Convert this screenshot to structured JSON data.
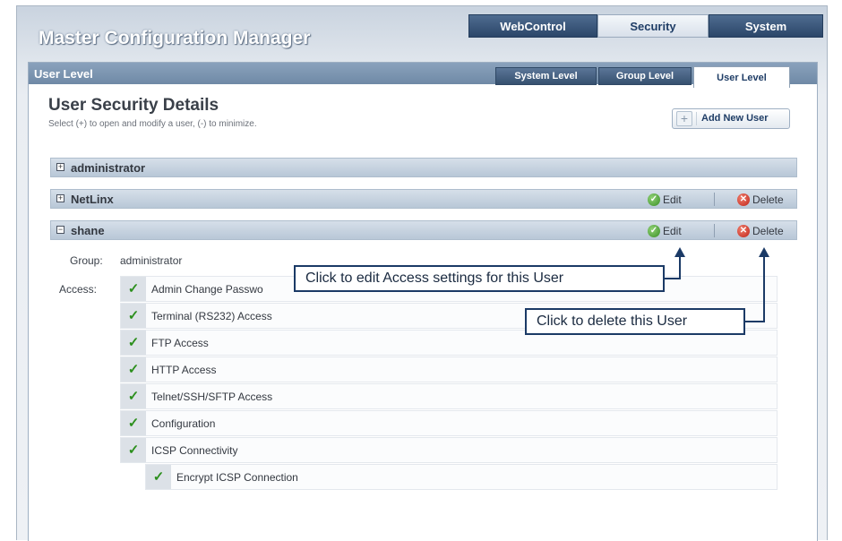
{
  "app": {
    "title": "Master Configuration Manager"
  },
  "main_tabs": [
    {
      "label": "WebControl",
      "state": "inactive"
    },
    {
      "label": "Security",
      "state": "active"
    },
    {
      "label": "System",
      "state": "inactive"
    }
  ],
  "panel": {
    "title": "User Level",
    "sub_tabs": [
      {
        "label": "System Level",
        "state": "inactive"
      },
      {
        "label": "Group Level",
        "state": "inactive"
      },
      {
        "label": "User Level",
        "state": "active"
      }
    ]
  },
  "section": {
    "title": "User Security Details",
    "subtitle": "Select (+) to open and modify a user, (-) to minimize."
  },
  "add_user_button": {
    "icon": "+",
    "label": "Add New User"
  },
  "users": [
    {
      "name": "administrator",
      "expanded": false,
      "toggle": "+"
    },
    {
      "name": "NetLinx",
      "expanded": false,
      "toggle": "+",
      "edit_label": "Edit",
      "delete_label": "Delete"
    },
    {
      "name": "shane",
      "expanded": true,
      "toggle": "−",
      "edit_label": "Edit",
      "delete_label": "Delete"
    }
  ],
  "details": {
    "group_label": "Group:",
    "group_value": "administrator",
    "access_label": "Access:",
    "access_items": [
      {
        "label": "Admin Change Passwo",
        "checked": true
      },
      {
        "label": "Terminal (RS232) Access",
        "checked": true
      },
      {
        "label": "FTP Access",
        "checked": true
      },
      {
        "label": "HTTP Access",
        "checked": true
      },
      {
        "label": "Telnet/SSH/SFTP Access",
        "checked": true
      },
      {
        "label": "Configuration",
        "checked": true
      },
      {
        "label": "ICSP Connectivity",
        "checked": true
      },
      {
        "label": "Encrypt ICSP Connection",
        "checked": true,
        "sub_item": true
      }
    ]
  },
  "callouts": {
    "edit": "Click to edit Access settings for this User",
    "delete": "Click to delete this User"
  },
  "colors": {
    "dark_tab": "#2b4669",
    "panel_header": "#7a93b0",
    "check_green": "#2c8f1d",
    "callout_border": "#1b3a66"
  }
}
